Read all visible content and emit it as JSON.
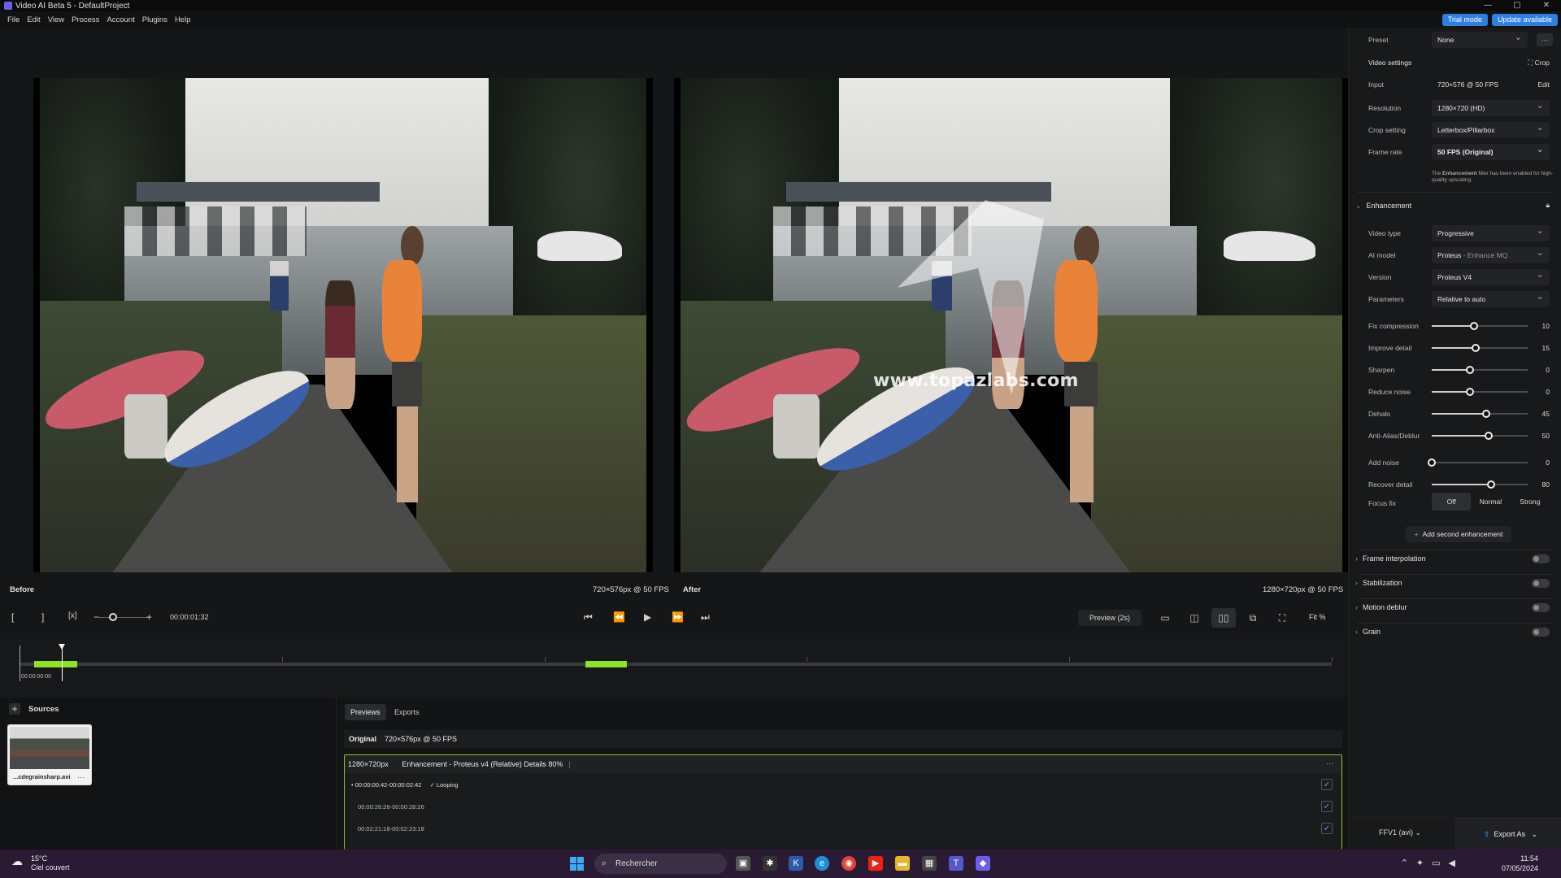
{
  "window": {
    "title": "Video AI Beta 5 - DefaultProject",
    "controls": [
      "—",
      "▢",
      "✕"
    ]
  },
  "menu": {
    "items": [
      "File",
      "Edit",
      "View",
      "Process",
      "Account",
      "Plugins",
      "Help"
    ]
  },
  "badges": {
    "trial": "Trial mode",
    "update": "Update available"
  },
  "preview": {
    "before_label": "Before",
    "before_res": "720×576px @ 50 FPS",
    "after_label": "After",
    "after_res": "1280×720px @ 50 FPS",
    "watermark": "www.topazlabs.com"
  },
  "controls": {
    "mark_in": "[",
    "mark_out": "]",
    "clear": "[x]",
    "zoom_minus": "−",
    "zoom_plus": "+",
    "timecode": "00:00:01:32",
    "preview_button": "Preview (2s)",
    "fit": "Fit %",
    "icons": {
      "skip_start": "⏮",
      "step_back": "⏪",
      "play": "▶",
      "step_fwd": "⏩",
      "skip_end": "⏭"
    }
  },
  "timeline": {
    "start_time": "00:00:00:00",
    "playhead_fraction": 0.032,
    "segments": [
      {
        "start": 0.011,
        "end": 0.044
      },
      {
        "start": 0.431,
        "end": 0.463
      }
    ],
    "ticks": [
      0.0,
      0.2,
      0.4,
      0.6,
      0.8,
      1.0
    ]
  },
  "sources": {
    "title": "Sources",
    "add": "+",
    "items": [
      {
        "name": "...cdegrainsharp.avi",
        "more": "···"
      }
    ]
  },
  "exports": {
    "tabs": [
      "Previews",
      "Exports"
    ],
    "original": {
      "label": "Original",
      "detail": "720×576px @ 50 FPS"
    },
    "job": {
      "res": "1280×720px",
      "desc": "Enhancement - Proteus v4 (Relative) Details 80%",
      "more": "···",
      "ranges": [
        {
          "range": "00:00:00:42-00:00:02:42",
          "looping": "✓ Looping",
          "checked": "✓"
        },
        {
          "range": "00:00:26:26-00:00:28:26",
          "checked": "✓"
        },
        {
          "range": "00:02:21:18-00:02:23:18",
          "checked": "✓"
        }
      ]
    }
  },
  "panel": {
    "preset": {
      "label": "Preset",
      "value": "None",
      "more": "···"
    },
    "video_settings": {
      "title": "Video settings",
      "crop": "Crop"
    },
    "input": {
      "label": "Input",
      "value": "720×576 @ 50 FPS",
      "edit": "Edit"
    },
    "resolution": {
      "label": "Resolution",
      "value": "1280×720 (HD)"
    },
    "crop_setting": {
      "label": "Crop setting",
      "value": "Letterbox/Pillarbox"
    },
    "frame_rate": {
      "label": "Frame rate",
      "value": "50 FPS (Original)"
    },
    "note_pre": "The ",
    "note_bold": "Enhancement",
    "note_post": " filter has been enabled for high-quality upscaling.",
    "enhancement": {
      "title": "Enhancement",
      "video_type": {
        "label": "Video type",
        "value": "Progressive"
      },
      "ai_model": {
        "label": "AI model",
        "value": "Proteus",
        "suffix": " - Enhance MQ"
      },
      "version": {
        "label": "Version",
        "value": "Proteus V4"
      },
      "parameters": {
        "label": "Parameters",
        "value": "Relative to auto"
      },
      "sliders": [
        {
          "label": "Fix compression",
          "value": "10",
          "fraction": 0.44
        },
        {
          "label": "Improve detail",
          "value": "15",
          "fraction": 0.46
        },
        {
          "label": "Sharpen",
          "value": "0",
          "fraction": 0.4
        },
        {
          "label": "Reduce noise",
          "value": "0",
          "fraction": 0.4
        },
        {
          "label": "Dehalo",
          "value": "45",
          "fraction": 0.57
        },
        {
          "label": "Anti-Alias/Deblur",
          "value": "50",
          "fraction": 0.59
        },
        {
          "label": "Add noise",
          "value": "0",
          "fraction": 0.0
        },
        {
          "label": "Recover detail",
          "value": "80",
          "fraction": 0.62
        }
      ],
      "focus_fix": {
        "label": "Focus fix",
        "options": [
          "Off",
          "Normal",
          "Strong"
        ],
        "selected": "Off"
      },
      "add_second": "Add second enhancement",
      "add_icon": "+"
    },
    "sections": [
      "Frame interpolation",
      "Stabilization",
      "Motion deblur",
      "Grain"
    ],
    "codec": "FFV1 (avi)",
    "export": "Export As"
  },
  "taskbar": {
    "temp": "15°C",
    "weather": "Ciel couvert",
    "search": "Rechercher",
    "time": "11:54",
    "date": "07/05/2024"
  },
  "colors": {
    "accent": "#2e7fe0",
    "green": "#8fe22a",
    "blue_check": "#4da3ff"
  }
}
